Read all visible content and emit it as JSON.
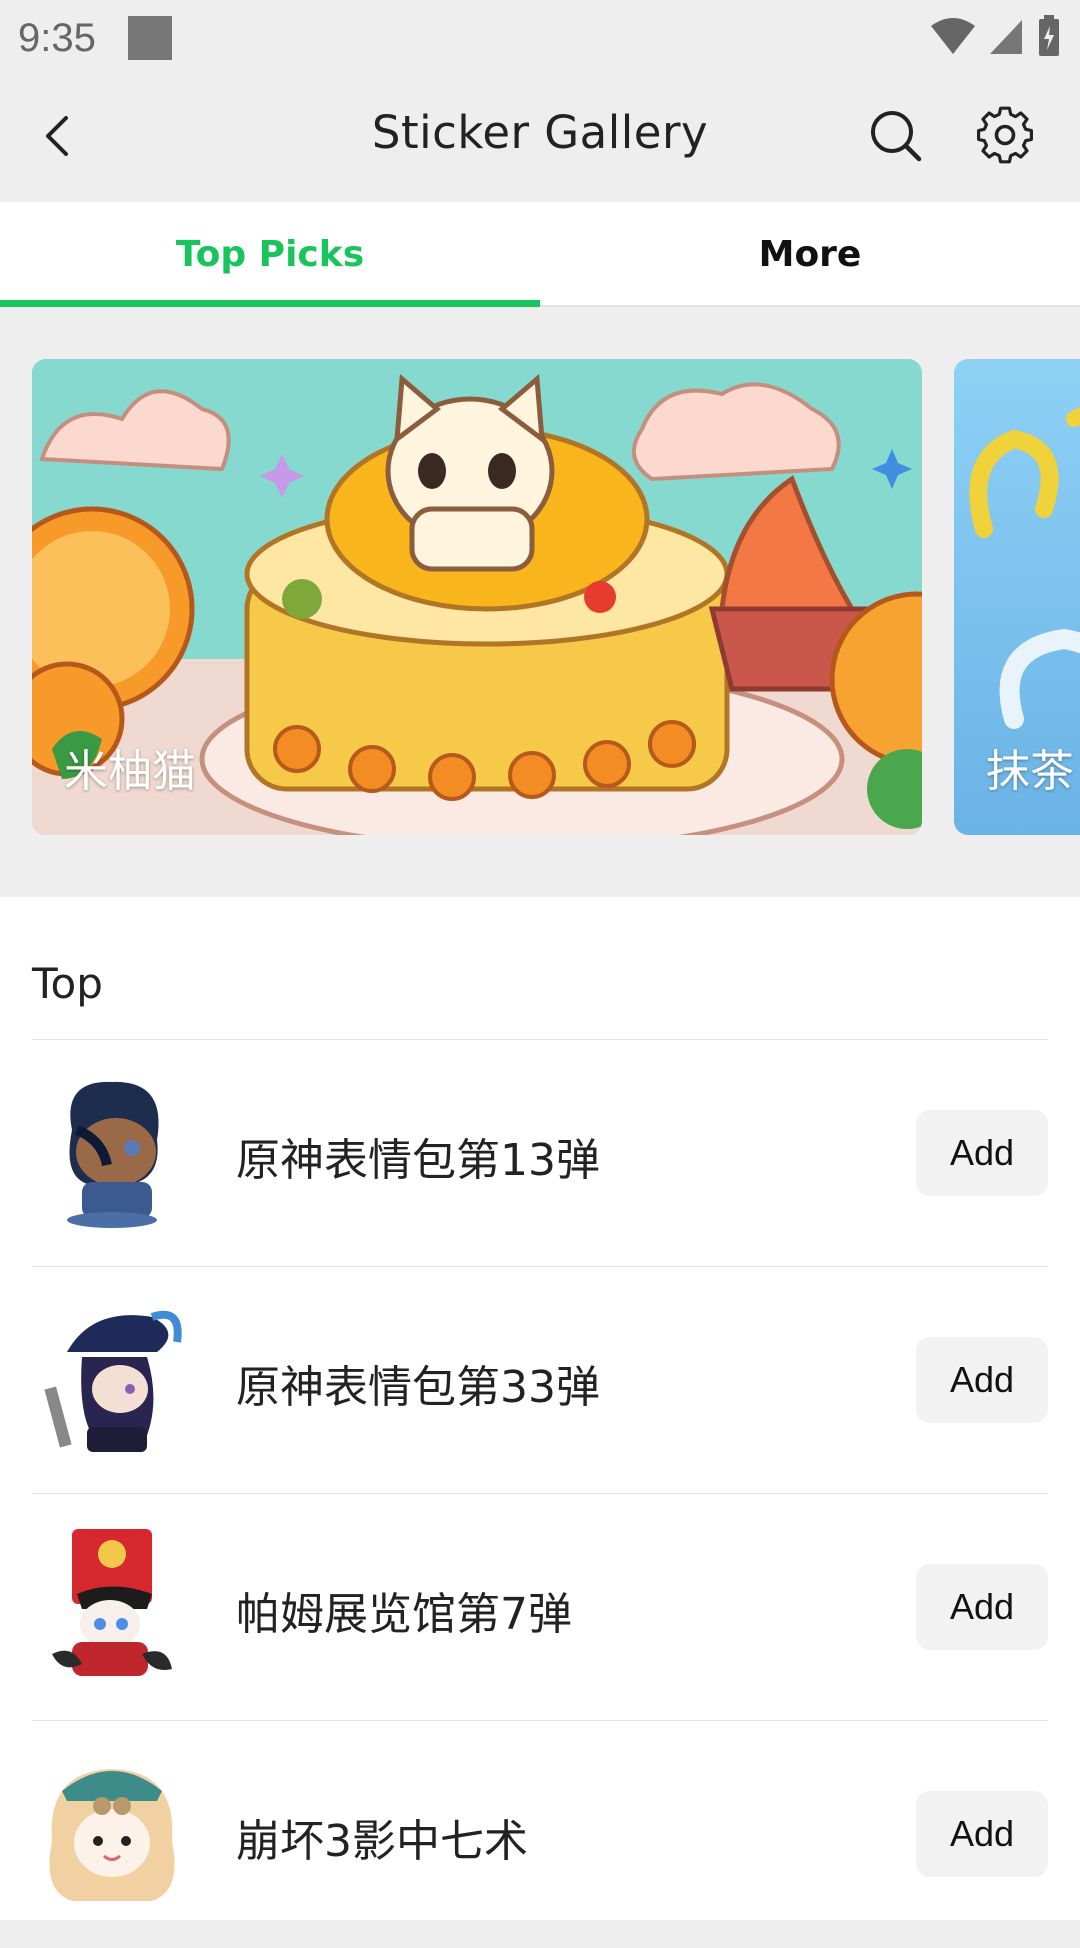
{
  "status_bar": {
    "time": "9:35",
    "icons": [
      "notification-square-icon",
      "wifi-icon",
      "cell-signal-icon",
      "battery-charging-icon"
    ]
  },
  "app_bar": {
    "title": "Sticker Gallery",
    "icons": [
      "back-arrow-icon",
      "search-icon",
      "gear-icon"
    ]
  },
  "tabs": [
    {
      "label": "Top Picks",
      "active": true
    },
    {
      "label": "More",
      "active": false
    }
  ],
  "banners": [
    {
      "label": "米柚猫"
    },
    {
      "label": "抹茶"
    }
  ],
  "section": {
    "title": "Top"
  },
  "sticker_list": [
    {
      "title": "原神表情包第13弹",
      "button": "Add"
    },
    {
      "title": "原神表情包第33弹",
      "button": "Add"
    },
    {
      "title": "帕姆展览馆第7弹",
      "button": "Add"
    },
    {
      "title": "崩坏3影中七术",
      "button": "Add"
    }
  ],
  "colors": {
    "accent": "#19c45c",
    "background": "#eeeeef",
    "surface": "#ffffff",
    "button_bg": "#f2f2f2"
  }
}
